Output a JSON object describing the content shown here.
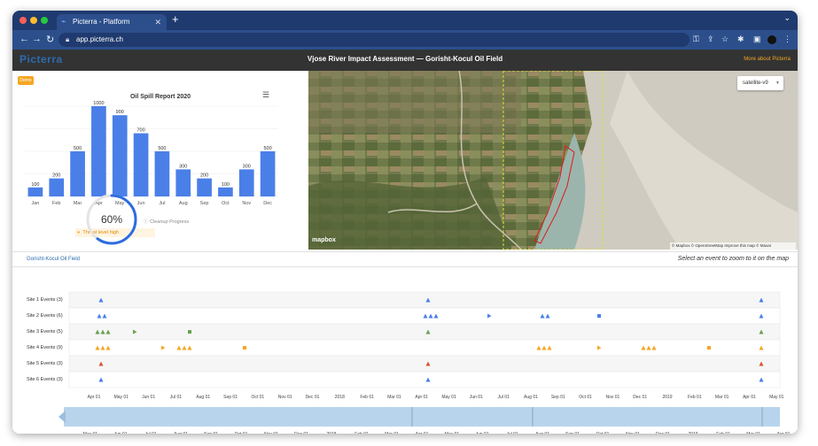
{
  "browser": {
    "tab_title": "Picterra - Platform",
    "new_tab_icon": "plus-icon",
    "url": "app.picterra.ch",
    "colors": {
      "tabbar": "#1f3a6e",
      "addrbar": "#2c4f8c"
    }
  },
  "app": {
    "logo": "Picterra",
    "title": "Vjose River Impact Assessment — Gorisht-Kocul Oil Field",
    "more_link": "More about Picterra",
    "accent": "#f5a623"
  },
  "chart_panel": {
    "badge": "Demo",
    "threat_label": "Threat level high",
    "progress_label": "Cleanup Progress",
    "progress_value": "60%",
    "progress_fraction": 0.6
  },
  "chart_data": {
    "type": "bar",
    "title": "Oil Spill Report 2020",
    "categories": [
      "Jan",
      "Feb",
      "Mar",
      "Apr",
      "May",
      "Jun",
      "Jul",
      "Aug",
      "Sep",
      "Oct",
      "Nov",
      "Dec"
    ],
    "values": [
      100,
      200,
      500,
      1000,
      900,
      700,
      500,
      300,
      200,
      100,
      300,
      500
    ],
    "ylim": [
      0,
      1000
    ],
    "grid": true,
    "bar_color": "#4a7fe8"
  },
  "map": {
    "style_selector": "satellite-v9",
    "logo": "mapbox",
    "attribution": "© Mapbox © OpenStreetMap Improve this map © Maxar"
  },
  "timeline": {
    "field_link": "Gorisht-Kocul Oil Field",
    "hint": "Select an event to zoom to it on the map",
    "rows": [
      "Site 1 Events (3)",
      "Site 2 Events (6)",
      "Site 3 Events (5)",
      "Site 4 Events (9)",
      "Site 5 Events (3)",
      "Site 6 Events (3)"
    ],
    "axis_labels": [
      "Apr 01",
      "May 01",
      "Jun 01",
      "Jul 01",
      "Aug 01",
      "Sep 01",
      "Oct 01",
      "Nov 01",
      "Dec 01",
      "2018",
      "Feb 01",
      "Mar 01",
      "Apr 01",
      "May 01",
      "Jun 01",
      "Jul 01",
      "Aug 01",
      "Sep 01",
      "Oct 01",
      "Nov 01",
      "Dec 01",
      "2019",
      "Feb 01",
      "Mar 01",
      "Apr 01",
      "May 01"
    ],
    "overview_labels": [
      "May 01",
      "Jun 01",
      "Jul 01",
      "Aug 01",
      "Sep 01",
      "Oct 01",
      "Nov 01",
      "Dec 01",
      "2018",
      "Feb 01",
      "Mar 01",
      "Apr 01",
      "May 01",
      "Jun 01",
      "Jul 01",
      "Aug 01",
      "Sep 01",
      "Oct 01",
      "Nov 01",
      "Dec 01",
      "2019",
      "Feb 01",
      "Mar 01",
      "Apr 01"
    ]
  }
}
